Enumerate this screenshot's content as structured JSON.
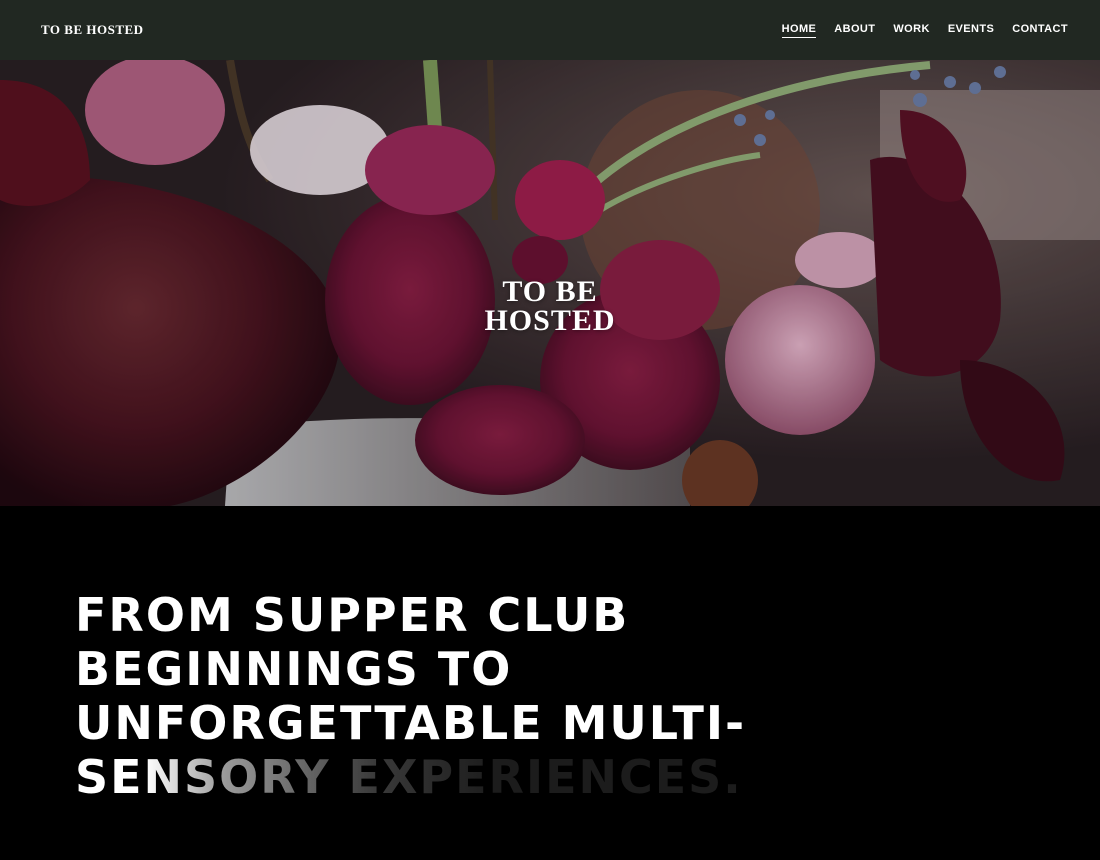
{
  "header": {
    "brand": "TO BE HOSTED",
    "nav": [
      {
        "label": "HOME",
        "active": true
      },
      {
        "label": "ABOUT"
      },
      {
        "label": "WORK"
      },
      {
        "label": "EVENTS"
      },
      {
        "label": "CONTACT"
      }
    ]
  },
  "hero": {
    "logo_line1": "TO BE",
    "logo_line2": "HOSTED"
  },
  "tagline": {
    "line1": "FROM SUPPER CLUB",
    "line2": "BEGINNINGS TO",
    "line3": "UNFORGETTABLE MULTI-",
    "line4": "SENSORY EXPERIENCES."
  },
  "colors": {
    "nav_bg": "#212822",
    "page_bg": "#000000",
    "text": "#ffffff"
  }
}
